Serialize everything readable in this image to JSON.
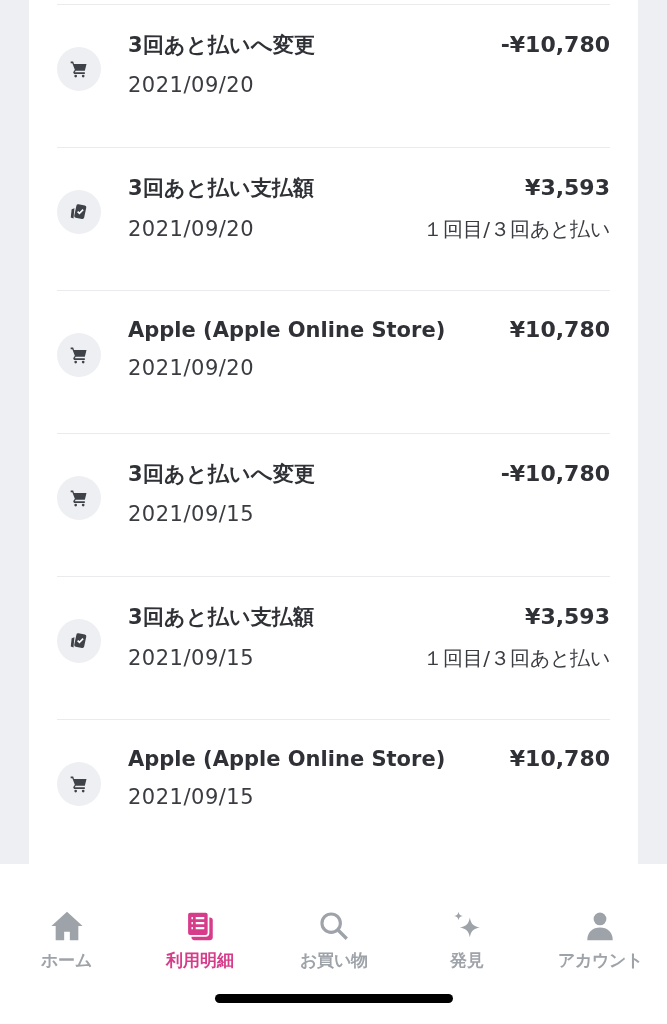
{
  "transactions": [
    {
      "kind": "cart",
      "title": "3回あと払いへ変更",
      "date": "2021/09/20",
      "amount": "-¥10,780"
    },
    {
      "kind": "cards",
      "title": "3回あと払い支払額",
      "date": "2021/09/20",
      "amount": "¥3,593",
      "note": "１回目/３回あと払い"
    },
    {
      "kind": "cart",
      "title": "Apple (Apple Online Store)",
      "date": "2021/09/20",
      "amount": "¥10,780"
    },
    {
      "kind": "cart",
      "title": "3回あと払いへ変更",
      "date": "2021/09/15",
      "amount": "-¥10,780"
    },
    {
      "kind": "cards",
      "title": "3回あと払い支払額",
      "date": "2021/09/15",
      "amount": "¥3,593",
      "note": "１回目/３回あと払い"
    },
    {
      "kind": "cart",
      "title": "Apple (Apple Online Store)",
      "date": "2021/09/15",
      "amount": "¥10,780"
    }
  ],
  "tab_bar": [
    {
      "kind": "home",
      "label": "ホーム",
      "selected": false
    },
    {
      "kind": "statement",
      "label": "利用明細",
      "selected": true
    },
    {
      "kind": "search",
      "label": "お買い物",
      "selected": false
    },
    {
      "kind": "sparkle",
      "label": "発見",
      "selected": false
    },
    {
      "kind": "account",
      "label": "アカウント",
      "selected": false
    }
  ]
}
